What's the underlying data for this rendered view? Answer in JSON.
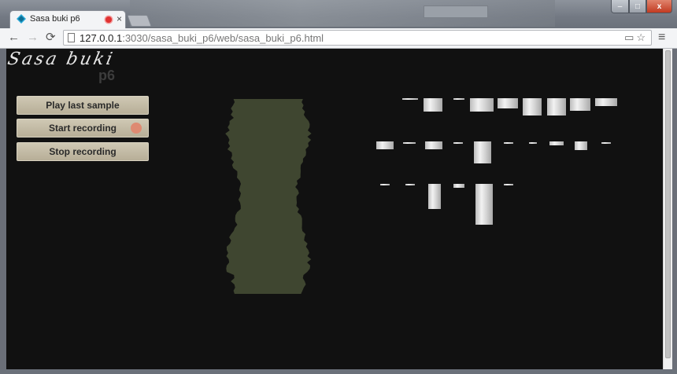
{
  "browser": {
    "tab_title": "Sasa buki p6",
    "tab_close": "×",
    "nav": {
      "back": "←",
      "forward": "→",
      "reload": "⟳"
    },
    "url_host": "127.0.0.1",
    "url_path": ":3030/sasa_buki_p6/web/sasa_buki_p6.html",
    "omnibox_icons": "▭☆",
    "menu": "≡",
    "window_buttons": {
      "minimize": "–",
      "maximize": "□",
      "close": "x"
    }
  },
  "app": {
    "logo_text": "Sasa buki",
    "logo_sub": "p6",
    "buttons": {
      "play_label": "Play last sample",
      "start_label": "Start recording",
      "stop_label": "Stop recording"
    },
    "recording_indicator_color": "#de8a72",
    "waveform_color": "#3f4630"
  }
}
